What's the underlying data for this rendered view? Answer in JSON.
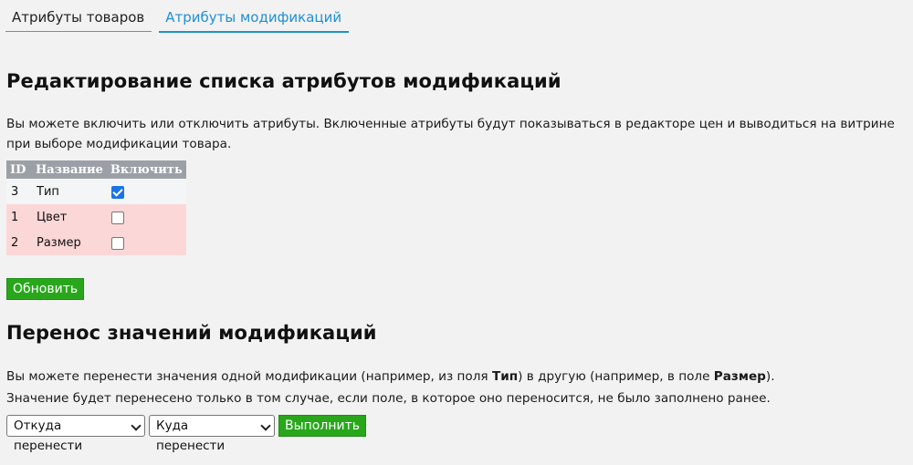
{
  "tabs": [
    {
      "label": "Атрибуты товаров"
    },
    {
      "label": "Атрибуты модификаций"
    }
  ],
  "section_edit": {
    "title": "Редактирование списка атрибутов модификаций",
    "description": "Вы можете включить или отключить атрибуты. Включенные атрибуты будут показываться в редакторе цен и выводиться на витрине при выборе модификации товара.",
    "table": {
      "headers": [
        "ID",
        "Название",
        "Включить"
      ],
      "rows": [
        {
          "id": "3",
          "name": "Тип",
          "enabled": true
        },
        {
          "id": "1",
          "name": "Цвет",
          "enabled": false
        },
        {
          "id": "2",
          "name": "Размер",
          "enabled": false
        }
      ]
    },
    "update_button": "Обновить"
  },
  "section_transfer": {
    "title": "Перенос значений модификаций",
    "line1_a": "Вы можете перенести значения одной модификации (например, из поля ",
    "line1_b": "Тип",
    "line1_c": ") в другую (например, в поле ",
    "line1_d": "Размер",
    "line1_e": ").",
    "line2": "Значение будет перенесено только в том случае, если поле, в которое оно переносится, не было заполнено ранее.",
    "from_select": "Откуда перенести",
    "to_select": "Куда перенести",
    "run_button": "Выполнить"
  },
  "colors": {
    "accent": "#1e90d4",
    "button_green": "#28a71b",
    "disabled_row": "#fcd7d7",
    "table_header": "#9ba0a6"
  }
}
